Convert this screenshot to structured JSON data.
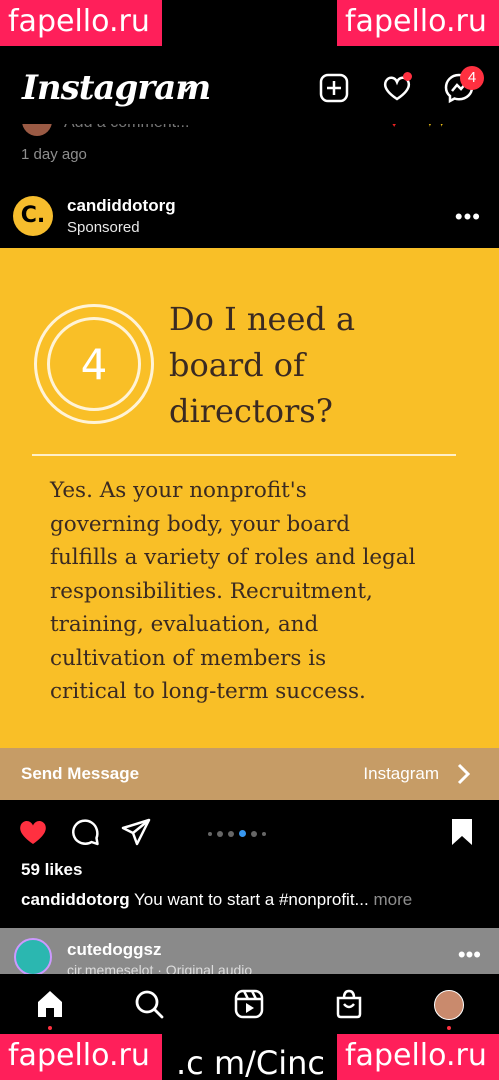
{
  "watermark": "fapello.ru",
  "watermark_footer": ".c m/Cinc",
  "header": {
    "app_title": "Instagram",
    "messages_count": "4"
  },
  "previous_post": {
    "comment_placeholder": "Add a comment...",
    "time_ago": "1 day ago"
  },
  "post": {
    "username": "candiddotorg",
    "sponsored_label": "Sponsored",
    "avatar_letter": "C.",
    "ad": {
      "number": "4",
      "title_lines": [
        "Do I need a",
        "board of",
        "directors?"
      ],
      "body_lines": [
        "Yes. As your nonprofit's",
        "governing body, your board",
        "fulfills a variety of roles and legal",
        "responsibilities. Recruitment,",
        "training, evaluation, and",
        "cultivation of members is",
        "critical to long-term success."
      ]
    },
    "cta": {
      "label": "Send Message",
      "source": "Instagram"
    },
    "carousel": {
      "count": 6,
      "active_index": 4
    },
    "likes": "59 likes",
    "caption_user": "candiddotorg",
    "caption_text": "You want to start a #nonprofit...",
    "caption_more": "more"
  },
  "next_post": {
    "username": "cutedoggsz",
    "subtitle": "cir.memeselot · Original audio"
  },
  "colors": {
    "ad_bg": "#f9bf27",
    "ad_text": "#3a2a22",
    "cta_bg": "#c69c66",
    "like_red": "#ff3040",
    "carousel_active": "#3897f0"
  },
  "icons": [
    "new-post-icon",
    "heart-icon",
    "messenger-icon",
    "chevron-right-icon",
    "like-icon",
    "comment-icon",
    "share-icon",
    "save-icon",
    "home-icon",
    "search-icon",
    "reels-icon",
    "shop-icon"
  ]
}
